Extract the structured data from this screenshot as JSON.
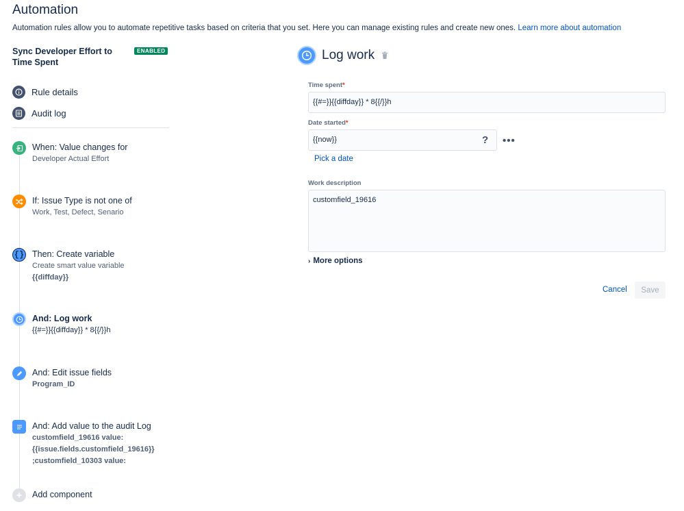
{
  "page": {
    "title": "Automation",
    "description": "Automation rules allow you to automate repetitive tasks based on criteria that you set. Here you can manage existing rules and create new ones.",
    "learn_more": "Learn more about automation"
  },
  "rule": {
    "name": "Sync Developer Effort to Time Spent",
    "status": "ENABLED"
  },
  "nav": {
    "rule_details": "Rule details",
    "audit_log": "Audit log"
  },
  "steps": [
    {
      "title": "When: Value changes for",
      "sub1": "Developer Actual Effort",
      "icon": "trigger-icon",
      "color": "#36b37e"
    },
    {
      "title": "If: Issue Type is not one of",
      "sub1": "Work, Test, Defect, Senario",
      "icon": "shuffle-icon",
      "color": "#ff8b00"
    },
    {
      "title": "Then: Create variable",
      "sub1": "Create smart value variable",
      "sub2": "{{diffday}}",
      "icon": "braces-icon",
      "color": "#4c9aff"
    },
    {
      "title": "And: Log work",
      "sub1": "{{#=}}{{diffday}} * 8{{/}}h",
      "icon": "clock-icon",
      "color": "#4c9aff"
    },
    {
      "title": "And: Edit issue fields",
      "sub1": "Program_ID",
      "icon": "pencil-icon",
      "color": "#4c9aff"
    },
    {
      "title": "And: Add value to the audit Log",
      "sub1": "customfield_19616 value:",
      "sub2": "{{issue.fields.customfield_19616}}",
      "sub3": ";customfield_10303 value:",
      "icon": "list-icon",
      "color": "#4c9aff"
    }
  ],
  "add_component": "Add component",
  "editor": {
    "title": "Log work",
    "time_spent_label": "Time spent",
    "time_spent_value": "{{#=}}{{diffday}} * 8{{/}}h",
    "date_started_label": "Date started",
    "date_started_value": "{{now}}",
    "help": "?",
    "pick_date": "Pick a date",
    "work_desc_label": "Work description",
    "work_desc_value": "customfield_19616",
    "more_options": "More options",
    "cancel": "Cancel",
    "save": "Save",
    "required_mark": "*"
  }
}
